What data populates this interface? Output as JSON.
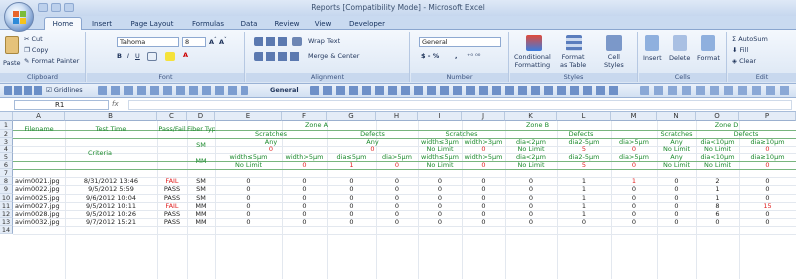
{
  "window": {
    "title": "Reports [Compatibility Mode] - Microsoft Excel"
  },
  "tabs": [
    "Home",
    "Insert",
    "Page Layout",
    "Formulas",
    "Data",
    "Review",
    "View",
    "Developer"
  ],
  "ribbon": {
    "clipboard": {
      "paste": "Paste",
      "cut": "Cut",
      "copy": "Copy",
      "format_painter": "Format Painter",
      "label": "Clipboard"
    },
    "font": {
      "name": "Tahoma",
      "size": "8",
      "label": "Font"
    },
    "alignment": {
      "wrap": "Wrap Text",
      "merge": "Merge & Center",
      "label": "Alignment"
    },
    "number": {
      "format": "General",
      "pct": "$ - %",
      "comma": ",",
      "label": "Number"
    },
    "styles": {
      "cond": "Conditional",
      "cond2": "Formatting",
      "fmt_table": "Format",
      "fmt_table2": "as Table",
      "cell": "Cell",
      "cell2": "Styles",
      "label": "Styles"
    },
    "cells": {
      "insert": "Insert",
      "delete": "Delete",
      "format": "Format",
      "label": "Cells"
    },
    "editing": {
      "autosum": "AutoSum",
      "fill": "Fill",
      "clear": "Clear",
      "label": "Edit"
    }
  },
  "toolbar2": {
    "gridlines": "Gridlines",
    "format": "General"
  },
  "formula_bar": {
    "name_box": "R1",
    "fx": "fx",
    "value": ""
  },
  "columns": [
    "A",
    "B",
    "C",
    "D",
    "E",
    "F",
    "G",
    "H",
    "I",
    "J",
    "K",
    "L",
    "M",
    "N",
    "O",
    "P"
  ],
  "rows": [
    "1",
    "2",
    "3",
    "4",
    "5",
    "6",
    "7",
    "8",
    "9",
    "10",
    "11",
    "12",
    "13",
    "14"
  ],
  "sheet": {
    "h_filename": "Filename",
    "h_testtime": "Test Time",
    "h_passfail": "Pass/Fail",
    "h_fibertype": "Fiber Type",
    "zoneA": "Zone A",
    "zoneB": "Zone B",
    "zoneD": "Zone D",
    "scratches": "Scratches",
    "defects": "Defects",
    "criteria": "Criteria",
    "sm": "SM",
    "mm": "MM",
    "any": "Any",
    "zero": "0",
    "nolimit": "No Limit",
    "one": "1",
    "five": "5",
    "w_le3": "width≤3µm",
    "w_gt3": "width>3µm",
    "w_le5": "width≤5µm",
    "w_gt5": "width>5µm",
    "d_lt2": "dia<2µm",
    "d_2_5": "dia2-5µm",
    "d_gt5": "dia>5µm",
    "d_le5": "dia≤5µm",
    "d_lt10": "dia<10µm",
    "d_ge10": "dia≥10µm"
  },
  "data_rows": [
    {
      "file": "avim0021.jpg",
      "time": "8/31/2012 13:46",
      "pf": "FAIL",
      "fiber": "SM",
      "e": "0",
      "f": "0",
      "g": "0",
      "h": "0",
      "i": "0",
      "j": "0",
      "k": "0",
      "l": "1",
      "m": "1",
      "n": "0",
      "o": "2",
      "p": "0"
    },
    {
      "file": "avim0022.jpg",
      "time": "9/5/2012 5:59",
      "pf": "PASS",
      "fiber": "SM",
      "e": "0",
      "f": "0",
      "g": "0",
      "h": "0",
      "i": "0",
      "j": "0",
      "k": "0",
      "l": "1",
      "m": "0",
      "n": "0",
      "o": "1",
      "p": "0"
    },
    {
      "file": "avim0025.jpg",
      "time": "9/6/2012 10:04",
      "pf": "PASS",
      "fiber": "SM",
      "e": "0",
      "f": "0",
      "g": "0",
      "h": "0",
      "i": "0",
      "j": "0",
      "k": "0",
      "l": "1",
      "m": "0",
      "n": "0",
      "o": "1",
      "p": "0"
    },
    {
      "file": "avim0027.jpg",
      "time": "9/5/2012 10:11",
      "pf": "FAIL",
      "fiber": "MM",
      "e": "0",
      "f": "0",
      "g": "0",
      "h": "0",
      "i": "0",
      "j": "0",
      "k": "0",
      "l": "1",
      "m": "0",
      "n": "0",
      "o": "8",
      "p": "15"
    },
    {
      "file": "avim0028.jpg",
      "time": "9/5/2012 10:26",
      "pf": "PASS",
      "fiber": "MM",
      "e": "0",
      "f": "0",
      "g": "0",
      "h": "0",
      "i": "0",
      "j": "0",
      "k": "0",
      "l": "1",
      "m": "0",
      "n": "0",
      "o": "6",
      "p": "0"
    },
    {
      "file": "avim0032.jpg",
      "time": "9/7/2012 15:21",
      "pf": "PASS",
      "fiber": "MM",
      "e": "0",
      "f": "0",
      "g": "0",
      "h": "0",
      "i": "0",
      "j": "0",
      "k": "0",
      "l": "0",
      "m": "0",
      "n": "0",
      "o": "0",
      "p": "0"
    }
  ]
}
